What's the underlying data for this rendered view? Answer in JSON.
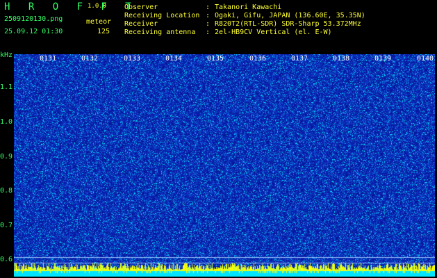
{
  "header": {
    "app_name": "H R O F F T",
    "app_version": "1.0.0",
    "file_name": "2509120130.png",
    "datetime": "25.09.12 01:30",
    "meteor_label": "meteor",
    "meteor_count": "125"
  },
  "info": {
    "observer_label": "Observer",
    "observer_value": "Takanori Kawachi",
    "location_label": "Receiving Location",
    "location_value": "Ogaki, Gifu, JAPAN (136.60E, 35.35N)",
    "receiver_label": "Receiver",
    "receiver_value": "R820T2(RTL-SDR) SDR-Sharp 53.372MHz",
    "antenna_label": "Receiving antenna",
    "antenna_value": "2el-HB9CV Vertical (el. E-W)",
    "separator": ":"
  },
  "axis": {
    "unit": "kHz",
    "y_ticks": [
      "1.1",
      "1.0",
      "0.9",
      "0.8",
      "0.7",
      "0.6"
    ],
    "x_ticks": [
      "0131",
      "0132",
      "0133",
      "0134",
      "0135",
      "0136",
      "0137",
      "0138",
      "0139",
      "0140"
    ]
  },
  "colors": {
    "background": "#000000",
    "waterfall_base": "#0a1fb0",
    "text_green": "#33ff66",
    "text_yellow": "#ffff33",
    "text_white": "#ffffff",
    "noise_cyan": "#00e5ff",
    "bottom_band_yellow": "#ffff00"
  }
}
